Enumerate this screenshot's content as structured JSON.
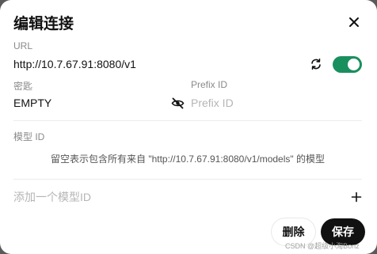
{
  "modal": {
    "title": "编辑连接",
    "url_label": "URL",
    "url_value": "http://10.7.67.91:8080/v1",
    "key_label": "密匙",
    "key_value": "EMPTY",
    "prefix_label": "Prefix ID",
    "prefix_placeholder": "Prefix ID",
    "model_label": "模型 ID",
    "model_hint": "留空表示包含所有来自 \"http://10.7.67.91:8080/v1/models\" 的模型",
    "add_model_placeholder": "添加一个模型ID",
    "delete_label": "删除",
    "save_label": "保存",
    "toggle_on": true
  },
  "watermark": "CSDN @超级小淘Bonz",
  "colors": {
    "accent": "#1a8f5e",
    "primary_button": "#111111"
  },
  "icons": [
    "close-icon",
    "refresh-icon",
    "eye-off-icon",
    "plus-icon"
  ]
}
